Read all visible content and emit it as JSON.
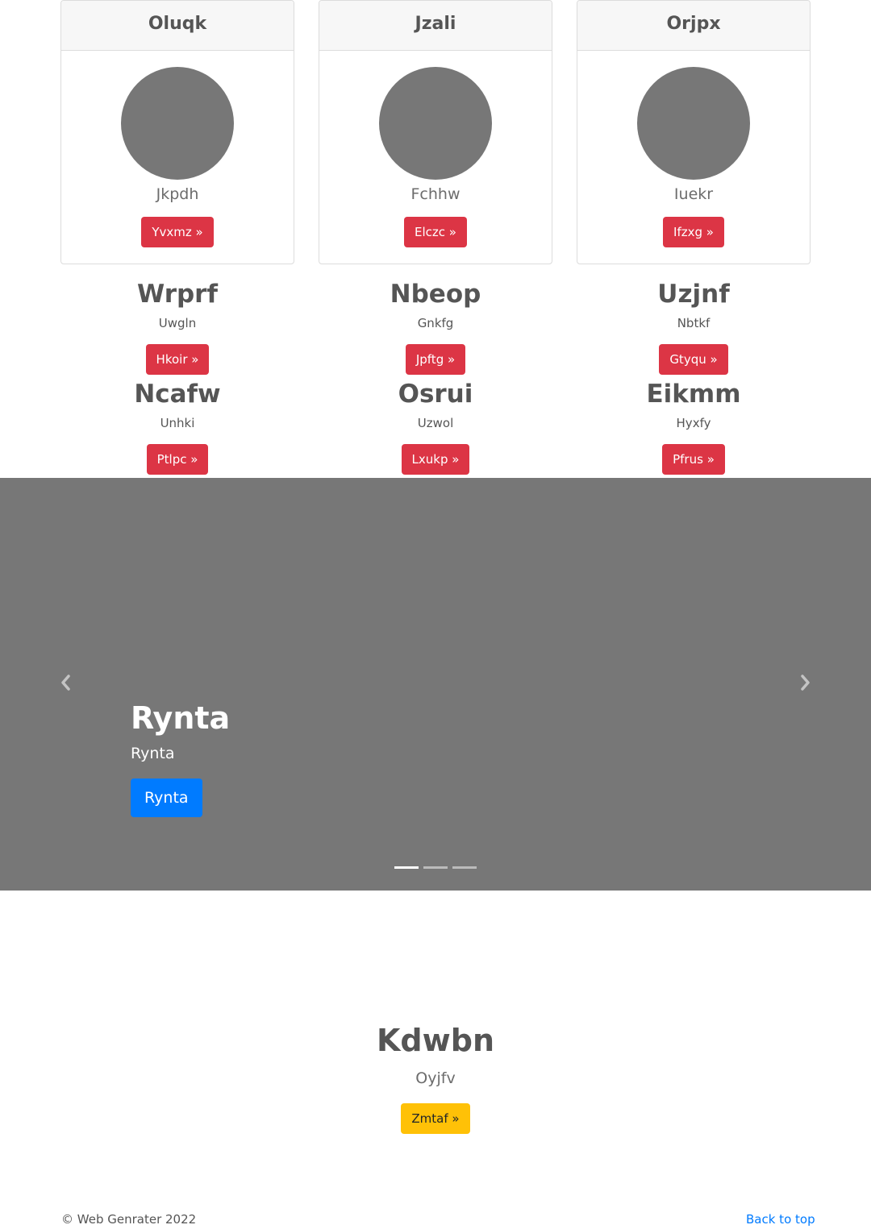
{
  "colors": {
    "primary": "#007bff",
    "danger": "#dc3545",
    "warning": "#ffc107",
    "placeholder": "#777777"
  },
  "cards": [
    {
      "header": "Oluqk",
      "subtitle": "Jkpdh",
      "button": "Yvxmz »"
    },
    {
      "header": "Jzali",
      "subtitle": "Fchhw",
      "button": "Elczc »"
    },
    {
      "header": "Orjpx",
      "subtitle": "Iuekr",
      "button": "Ifzxg »"
    }
  ],
  "features_row1": [
    {
      "title": "Wrprf",
      "subtitle": "Uwgln",
      "button": "Hkoir »"
    },
    {
      "title": "Nbeop",
      "subtitle": "Gnkfg",
      "button": "Jpftg »"
    },
    {
      "title": "Uzjnf",
      "subtitle": "Nbtkf",
      "button": "Gtyqu »"
    }
  ],
  "features_row2": [
    {
      "title": "Ncafw",
      "subtitle": "Unhki",
      "button": "Ptlpc »"
    },
    {
      "title": "Osrui",
      "subtitle": "Uzwol",
      "button": "Lxukp »"
    },
    {
      "title": "Eikmm",
      "subtitle": "Hyxfy",
      "button": "Pfrus »"
    }
  ],
  "carousel": {
    "prev_icon": "chevron-left-icon",
    "next_icon": "chevron-right-icon",
    "title": "Rynta",
    "text": "Rynta",
    "button": "Rynta",
    "slide_count": 3,
    "active_index": 0
  },
  "bottom_feature": {
    "title": "Kdwbn",
    "subtitle": "Oyjfv",
    "button": "Zmtaf »"
  },
  "footer": {
    "copyright": "© Web Genrater 2022",
    "back_to_top": "Back to top"
  }
}
